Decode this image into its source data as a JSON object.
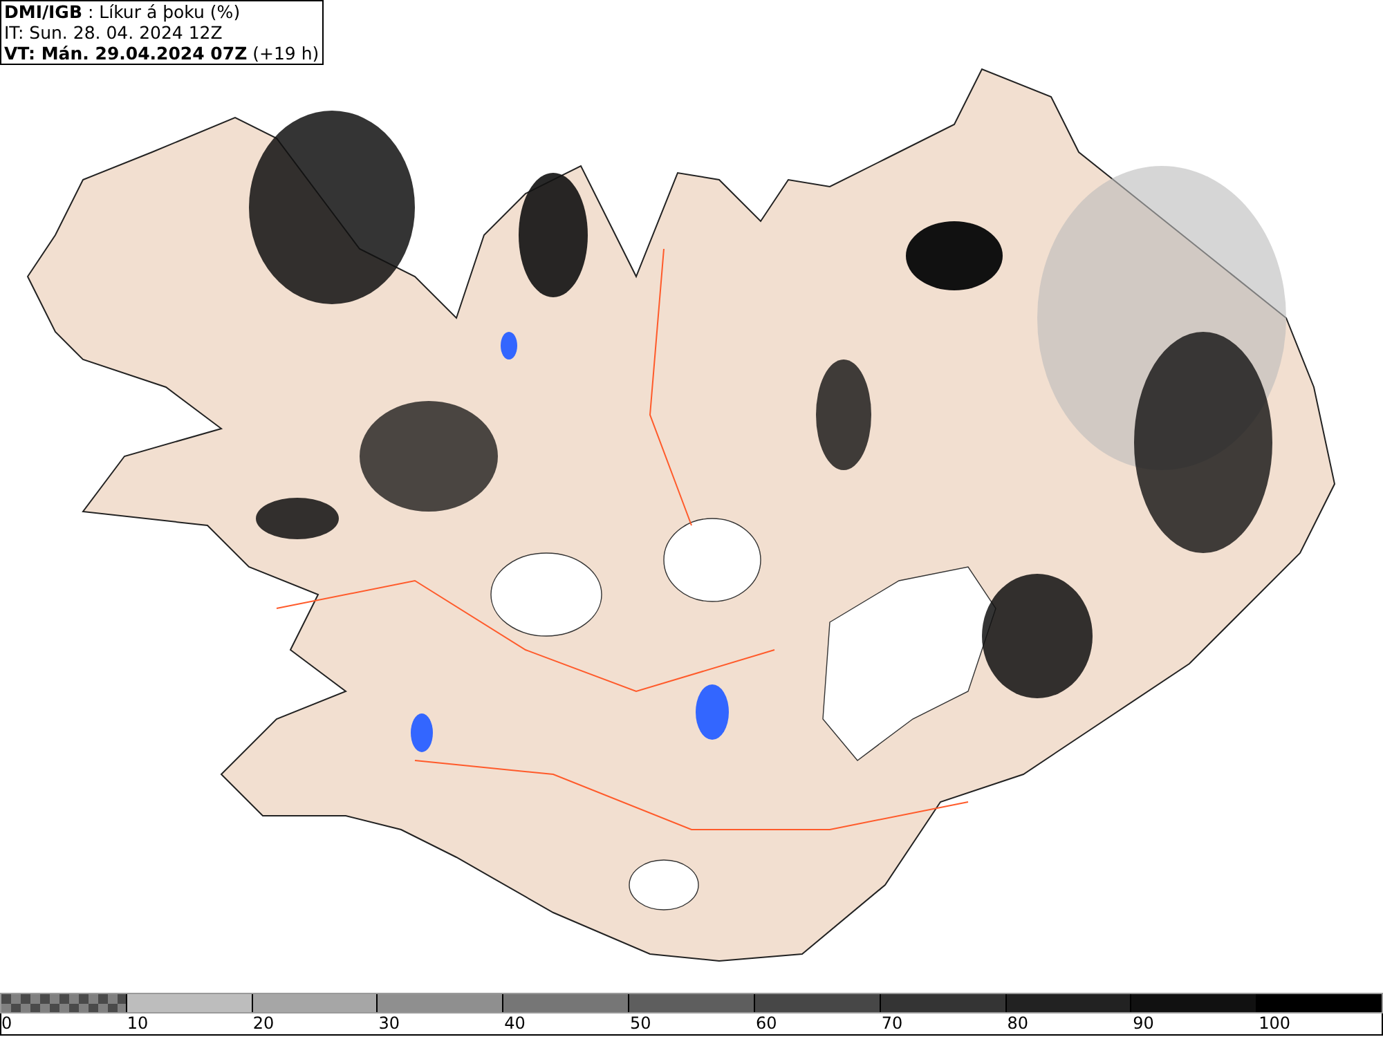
{
  "header": {
    "title": "**DMI/IGB** : Líkur á þoku (%)",
    "init_time": "IT: Sun. 28. 04. 2024 12Z",
    "valid_time": "**VT: Mán. 29.04.2024 07Z** (+19 h)"
  },
  "legend": {
    "segments": [
      {
        "kind": "checker",
        "color": "#4a4a4a"
      },
      {
        "kind": "solid",
        "color": "#bdbdbd"
      },
      {
        "kind": "solid",
        "color": "#a6a6a6"
      },
      {
        "kind": "solid",
        "color": "#8f8f8f"
      },
      {
        "kind": "solid",
        "color": "#767676"
      },
      {
        "kind": "solid",
        "color": "#5e5e5e"
      },
      {
        "kind": "solid",
        "color": "#474747"
      },
      {
        "kind": "solid",
        "color": "#343434"
      },
      {
        "kind": "solid",
        "color": "#222222"
      },
      {
        "kind": "solid",
        "color": "#111111"
      },
      {
        "kind": "solid",
        "color": "#000000"
      }
    ],
    "labels": [
      "0",
      "10",
      "20",
      "30",
      "40",
      "50",
      "60",
      "70",
      "80",
      "90",
      "100"
    ]
  }
}
